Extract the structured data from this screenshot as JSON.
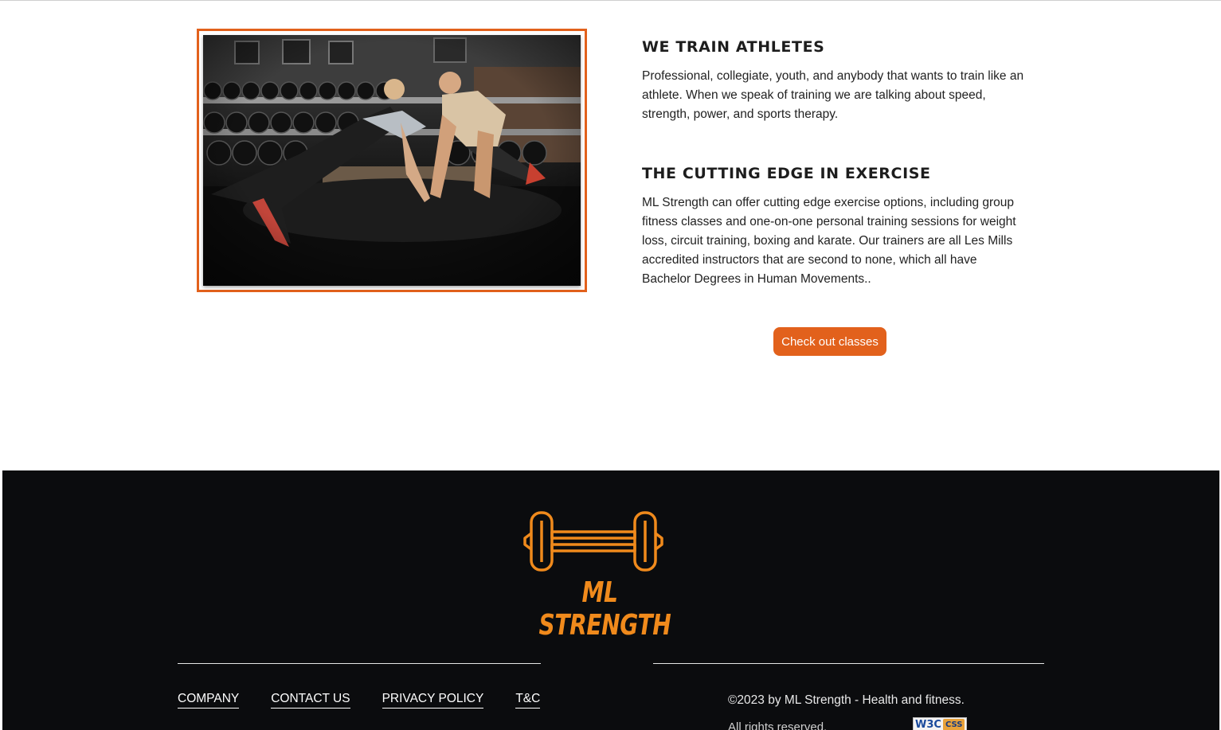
{
  "colors": {
    "accent": "#e2611c",
    "logo": "#f08a1c",
    "footer_bg": "#0b0c0e",
    "text": "#222222"
  },
  "feature": {
    "image_alt_icon": "workout-photo",
    "blocks": [
      {
        "heading": "WE TRAIN ATHLETES",
        "text": "Professional, collegiate, youth, and anybody that wants to train like an athlete. When we speak of training we are talking about speed, strength, power, and sports therapy."
      },
      {
        "heading": "THE CUTTING EDGE IN EXERCISE",
        "text": "ML Strength can offer cutting edge exercise options, including group fitness classes and one-on-one personal training sessions for weight loss, circuit training, boxing and karate. Our trainers are all Les Mills accredited instructors that are second to none, which all have Bachelor Degrees in Human Movements.."
      }
    ],
    "cta_label": "Check out classes"
  },
  "footer": {
    "logo_icon": "dumbbell-icon",
    "logo_text": "ML STRENGTH",
    "nav": [
      "COMPANY",
      "CONTACT US",
      "PRIVACY POLICY",
      "T&C"
    ],
    "copyright": "©2023 by ML Strength - Health and fitness.",
    "rights": "All rights reserved.",
    "badge": {
      "w3": "W3C",
      "css": "CSS"
    }
  }
}
